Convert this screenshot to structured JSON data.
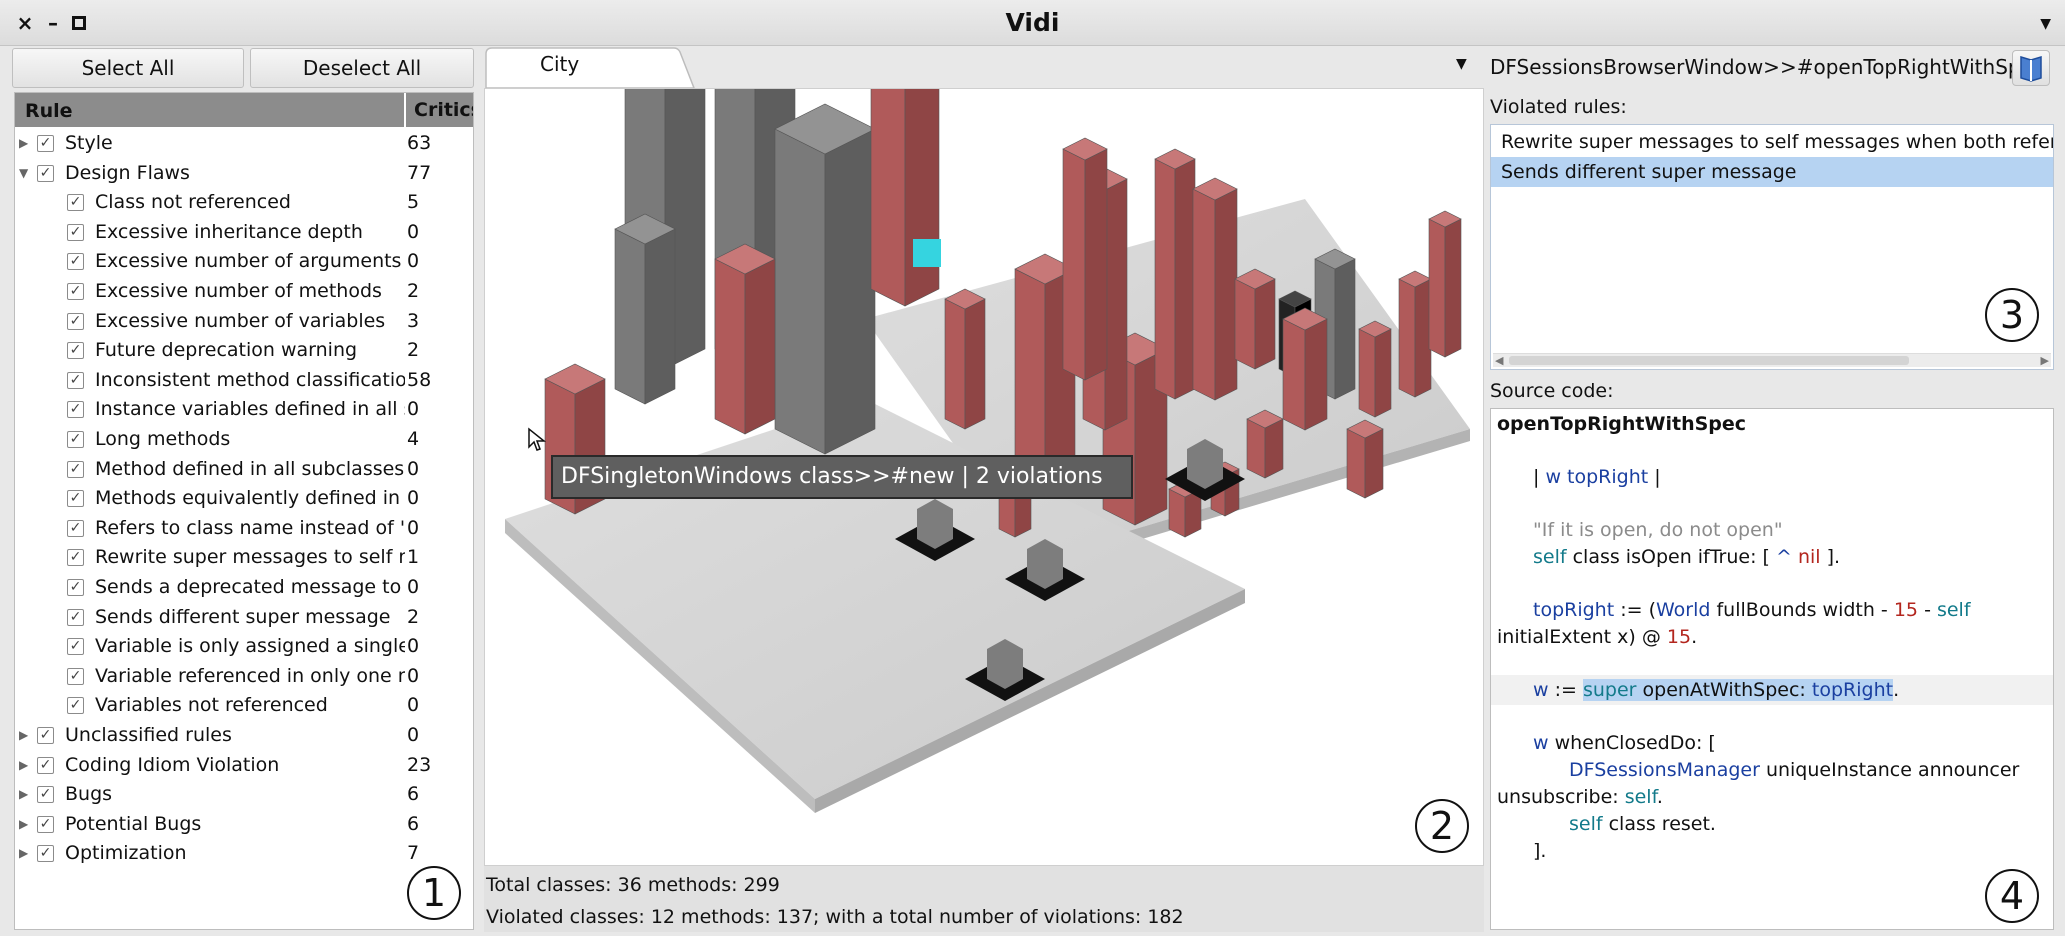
{
  "window": {
    "title": "Vidi",
    "close": "×",
    "minimize": "–",
    "maximize": "▪",
    "menu": "▼"
  },
  "left": {
    "select_all": "Select All",
    "deselect_all": "Deselect All",
    "col_rule": "Rule",
    "col_critics": "Critics",
    "rows": [
      {
        "label": "Style",
        "value": "63",
        "level": 0,
        "expanded": false
      },
      {
        "label": "Design Flaws",
        "value": "77",
        "level": 0,
        "expanded": true
      },
      {
        "label": "Class not referenced",
        "value": "5",
        "level": 1
      },
      {
        "label": "Excessive inheritance depth",
        "value": "0",
        "level": 1
      },
      {
        "label": "Excessive number of arguments",
        "value": "0",
        "level": 1
      },
      {
        "label": "Excessive number of methods",
        "value": "2",
        "level": 1
      },
      {
        "label": "Excessive number of variables",
        "value": "3",
        "level": 1
      },
      {
        "label": "Future deprecation warning",
        "value": "2",
        "level": 1
      },
      {
        "label": "Inconsistent method classificatio",
        "value": "58",
        "level": 1
      },
      {
        "label": "Instance variables defined in all s",
        "value": "0",
        "level": 1
      },
      {
        "label": "Long methods",
        "value": "4",
        "level": 1
      },
      {
        "label": "Method defined in all subclasses,",
        "value": "0",
        "level": 1
      },
      {
        "label": "Methods equivalently defined in :",
        "value": "0",
        "level": 1
      },
      {
        "label": "Refers to class name instead of \":",
        "value": "0",
        "level": 1
      },
      {
        "label": "Rewrite super messages to self m",
        "value": "1",
        "level": 1
      },
      {
        "label": "Sends a deprecated message to a",
        "value": "0",
        "level": 1
      },
      {
        "label": "Sends different super message",
        "value": "2",
        "level": 1
      },
      {
        "label": "Variable is only assigned a single",
        "value": "0",
        "level": 1
      },
      {
        "label": "Variable referenced in only one n",
        "value": "0",
        "level": 1
      },
      {
        "label": "Variables not referenced",
        "value": "0",
        "level": 1
      },
      {
        "label": "Unclassified rules",
        "value": "0",
        "level": 0,
        "expanded": false
      },
      {
        "label": "Coding Idiom Violation",
        "value": "23",
        "level": 0,
        "expanded": false
      },
      {
        "label": "Bugs",
        "value": "6",
        "level": 0,
        "expanded": false
      },
      {
        "label": "Potential Bugs",
        "value": "6",
        "level": 0,
        "expanded": false
      },
      {
        "label": "Optimization",
        "value": "7",
        "level": 0,
        "expanded": false
      }
    ],
    "check": "✓",
    "arrow_closed": "▶",
    "arrow_open": "▼"
  },
  "center": {
    "tab": "City",
    "tab_menu": "▼",
    "tooltip": "DFSingletonWindows class>>#new | 2 violations",
    "stats_line1": "Total classes: 36 methods: 299",
    "stats_line2": "Violated classes: 12 methods: 137; with a total number of violations: 182"
  },
  "right": {
    "method_title": "DFSessionsBrowserWindow>>#openTopRightWithSpec",
    "violated_label": "Violated rules:",
    "violated": [
      "Rewrite super messages to self messages when both refer t",
      "Sends different super message"
    ],
    "source_label": "Source code:",
    "code": {
      "sel": "openTopRightWithSpec",
      "temps_a": "| ",
      "temps_b": "w topRight",
      "temps_c": " |",
      "comment": "\"If it is open, do not open\"",
      "l4a": "self",
      "l4b": " class isOpen ifTrue: [ ",
      "l4c": "^",
      "l4d": " nil",
      "l4e": " ].",
      "l5a": "topRight",
      "l5b": " := (",
      "l5c": "World",
      "l5d": " fullBounds width - ",
      "l5e": "15",
      "l5f": " - ",
      "l5g": "self",
      "l6a": "initialExtent x) @ ",
      "l6b": "15",
      "l6c": ".",
      "l7a": "w",
      "l7b": " := ",
      "l7c": "super",
      "l7d": " openAtWithSpec: ",
      "l7e": "topRight",
      "l7f": ".",
      "l8a": "w",
      "l8b": " whenClosedDo: [",
      "l9a": "DFSessionsManager",
      "l9b": " uniqueInstance announcer",
      "l10a": "unsubscribe: ",
      "l10b": "self",
      "l10c": ".",
      "l11a": "self",
      "l11b": " class reset.",
      "l12": "]."
    }
  },
  "markers": {
    "one": "1",
    "two": "2",
    "three": "3",
    "four": "4"
  }
}
